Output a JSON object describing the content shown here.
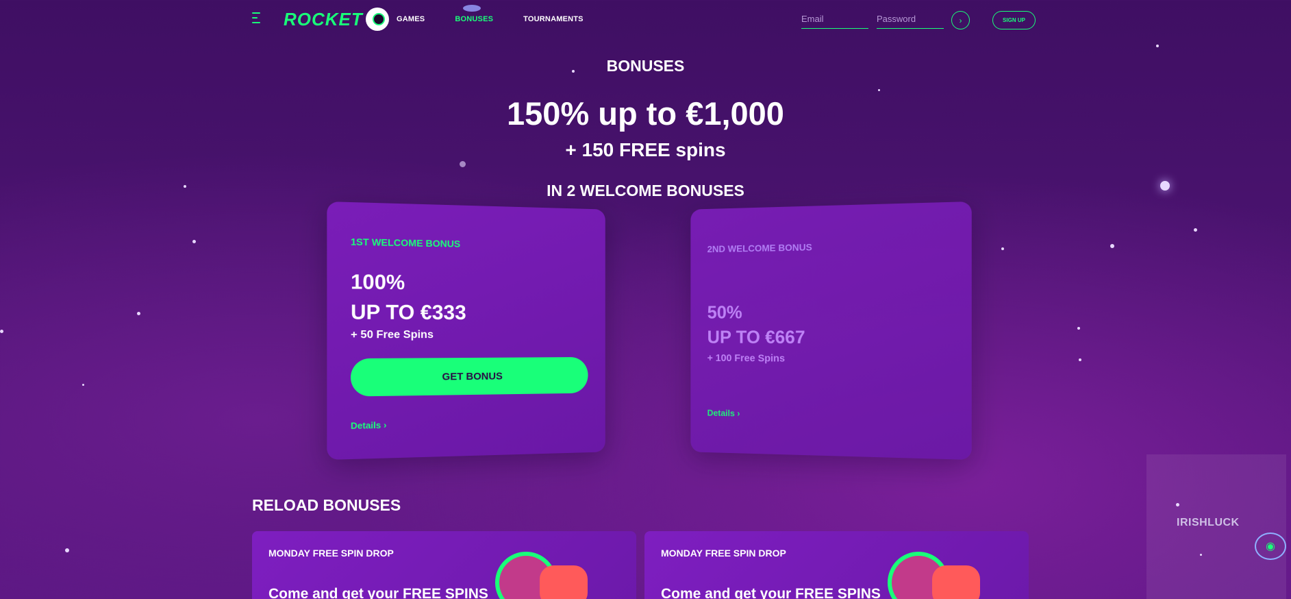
{
  "header": {
    "logo_text": "ROCKET",
    "nav": [
      {
        "label": "GAMES"
      },
      {
        "label": "BONUSES"
      },
      {
        "label": "TOURNAMENTS"
      }
    ],
    "email_placeholder": "Email",
    "password_placeholder": "Password",
    "go_icon": "›",
    "signup_label": "SIGN UP"
  },
  "hero": {
    "section_title": "BONUSES",
    "headline": "150% up to €1,000",
    "subline": "+ 150 FREE spins",
    "welcome_title": "IN 2 WELCOME BONUSES"
  },
  "welcome_cards": [
    {
      "label": "1ST WELCOME BONUS",
      "percent": "100%",
      "amount": "UP TO €333",
      "spins": "+ 50 Free Spins",
      "button": "GET BONUS",
      "details": "Details ›"
    },
    {
      "label": "2ND WELCOME BONUS",
      "percent": "50%",
      "amount": "UP TO €667",
      "spins": "+ 100 Free Spins",
      "details": "Details ›"
    }
  ],
  "reload": {
    "title": "RELOAD BONUSES",
    "cards": [
      {
        "label": "MONDAY FREE SPIN DROP",
        "desc": "Come and get your FREE SPINS"
      },
      {
        "label": "MONDAY FREE SPIN DROP",
        "desc": "Come and get your FREE SPINS"
      }
    ]
  },
  "watermark": "IRISHLUCK",
  "colors": {
    "accent": "#19ff79",
    "background": "#4a136f",
    "card": "#7a1db8",
    "muted_card_text": "#c58aff"
  },
  "icons": {
    "menu": "menu-icon",
    "go": "arrow-right-icon",
    "support": "support-headset-icon"
  }
}
